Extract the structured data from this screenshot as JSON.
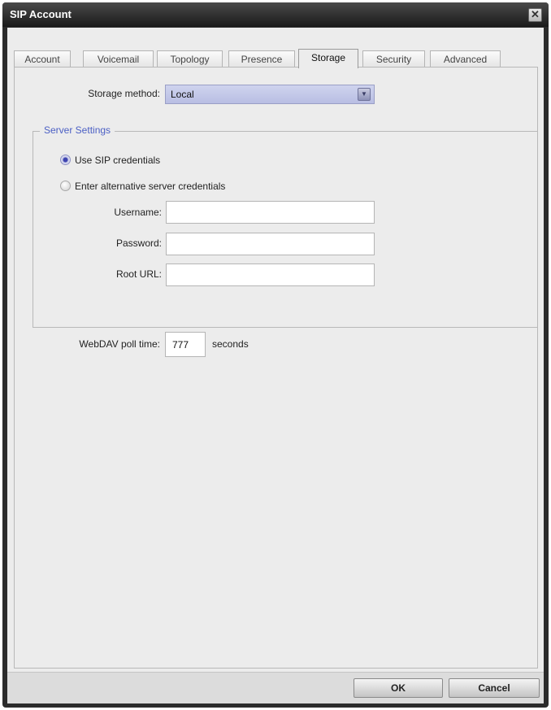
{
  "window": {
    "title": "SIP Account",
    "close_glyph": "✕"
  },
  "tabs": [
    {
      "label": "Account"
    },
    {
      "label": "Voicemail"
    },
    {
      "label": "Topology"
    },
    {
      "label": "Presence"
    },
    {
      "label": "Storage",
      "active": true
    },
    {
      "label": "Security"
    },
    {
      "label": "Advanced"
    }
  ],
  "storage": {
    "method_label": "Storage method:",
    "method_value": "Local"
  },
  "server_settings": {
    "title": "Server Settings",
    "radio_sip": "Use SIP credentials",
    "radio_alt": "Enter alternative server credentials",
    "selected": "radio_sip",
    "username_label": "Username:",
    "username_value": "",
    "password_label": "Password:",
    "password_value": "",
    "root_url_label": "Root URL:",
    "root_url_value": "",
    "poll_label": "WebDAV poll time:",
    "poll_value": "777",
    "poll_unit": "seconds"
  },
  "footer": {
    "ok_label": "OK",
    "cancel_label": "Cancel"
  },
  "icons": {
    "dropdown": "chevron-down-icon",
    "close": "close-icon"
  },
  "colors": {
    "accent": "#4b5fc4",
    "titlebar": "#1a1a1a",
    "select_bg": "#c3c7ea"
  }
}
